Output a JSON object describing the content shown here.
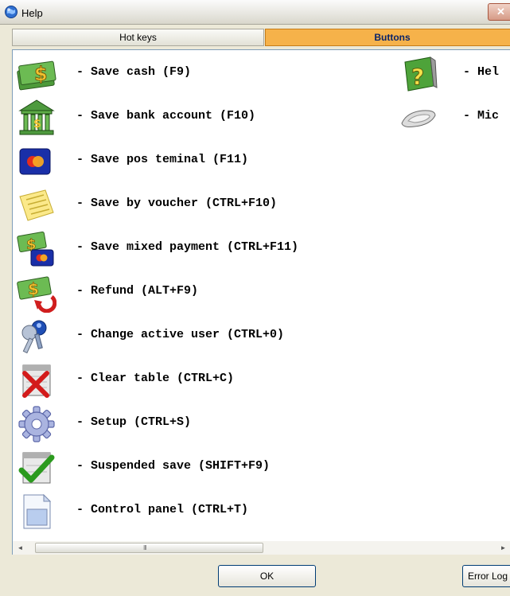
{
  "window": {
    "title": "Help",
    "close_glyph": "✕"
  },
  "tabs": [
    {
      "label": "Hot keys",
      "active": false
    },
    {
      "label": "Buttons",
      "active": true
    }
  ],
  "items_left": [
    {
      "icon": "cash-icon",
      "label": "- Save cash (F9)"
    },
    {
      "icon": "bank-icon",
      "label": "- Save bank account (F10)"
    },
    {
      "icon": "pos-card-icon",
      "label": "- Save pos teminal (F11)"
    },
    {
      "icon": "voucher-icon",
      "label": "- Save by voucher (CTRL+F10)"
    },
    {
      "icon": "mixed-payment-icon",
      "label": "- Save mixed payment (CTRL+F11)"
    },
    {
      "icon": "refund-icon",
      "label": "- Refund (ALT+F9)"
    },
    {
      "icon": "keys-user-icon",
      "label": "- Change active user (CTRL+0)"
    },
    {
      "icon": "clear-table-icon",
      "label": "- Clear table (CTRL+C)"
    },
    {
      "icon": "gear-icon",
      "label": "- Setup (CTRL+S)"
    },
    {
      "icon": "suspended-save-icon",
      "label": "- Suspended save (SHIFT+F9)"
    },
    {
      "icon": "control-panel-icon",
      "label": "- Control panel (CTRL+T)"
    }
  ],
  "items_right": [
    {
      "icon": "help-book-icon",
      "label": "- Hel"
    },
    {
      "icon": "mic-device-icon",
      "label": "- Mic"
    }
  ],
  "scrollbar": {
    "left_arrow": "◄",
    "right_arrow": "►",
    "grip": "III"
  },
  "footer": {
    "ok_label": "OK",
    "error_log_label": "Error Log"
  },
  "colors": {
    "active_tab": "#f6b24a",
    "content_bg": "#ffffff",
    "dialog_bg": "#ece9d8"
  }
}
